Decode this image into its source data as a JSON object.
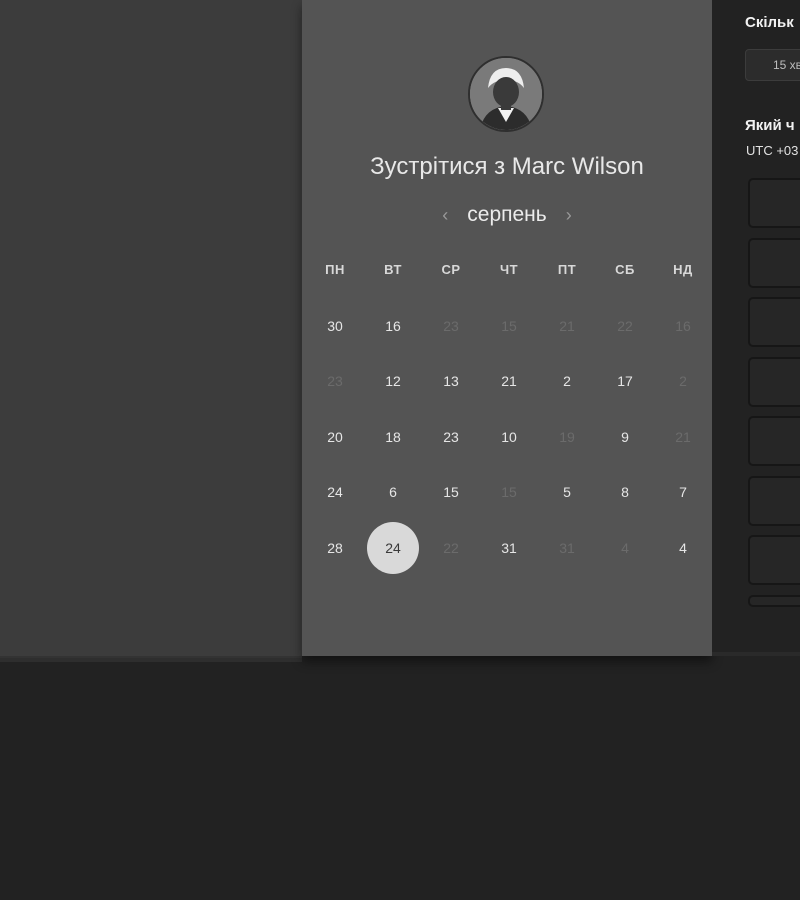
{
  "calendar": {
    "title": "Зустрітися з Marc Wilson",
    "month": "серпень",
    "prev_icon": "chevron-left-icon",
    "next_icon": "chevron-right-icon",
    "weekdays": [
      "ПН",
      "ВТ",
      "СР",
      "ЧТ",
      "ПТ",
      "СБ",
      "НД"
    ],
    "days": [
      {
        "label": "30",
        "available": true
      },
      {
        "label": "16",
        "available": true
      },
      {
        "label": "23",
        "available": false
      },
      {
        "label": "15",
        "available": false
      },
      {
        "label": "21",
        "available": false
      },
      {
        "label": "22",
        "available": false
      },
      {
        "label": "16",
        "available": false
      },
      {
        "label": "23",
        "available": false
      },
      {
        "label": "12",
        "available": true
      },
      {
        "label": "13",
        "available": true
      },
      {
        "label": "21",
        "available": true
      },
      {
        "label": "2",
        "available": true
      },
      {
        "label": "17",
        "available": true
      },
      {
        "label": "2",
        "available": false
      },
      {
        "label": "20",
        "available": true
      },
      {
        "label": "18",
        "available": true
      },
      {
        "label": "23",
        "available": true
      },
      {
        "label": "10",
        "available": true
      },
      {
        "label": "19",
        "available": false
      },
      {
        "label": "9",
        "available": true
      },
      {
        "label": "21",
        "available": false
      },
      {
        "label": "24",
        "available": true
      },
      {
        "label": "6",
        "available": true
      },
      {
        "label": "15",
        "available": true
      },
      {
        "label": "15",
        "available": false
      },
      {
        "label": "5",
        "available": true
      },
      {
        "label": "8",
        "available": true
      },
      {
        "label": "7",
        "available": true
      },
      {
        "label": "28",
        "available": true
      },
      {
        "label": "24",
        "available": true,
        "selected": true
      },
      {
        "label": "22",
        "available": false
      },
      {
        "label": "31",
        "available": true
      },
      {
        "label": "31",
        "available": false
      },
      {
        "label": "4",
        "available": false
      },
      {
        "label": "4",
        "available": true
      }
    ]
  },
  "sidebar": {
    "duration_heading": "Скільк",
    "duration_value": "15 хв",
    "time_heading": "Який ч",
    "timezone": "UTC +03",
    "slots_count": 8
  },
  "colors": {
    "background": "#222222",
    "left_pane": "#3c3c3c",
    "calendar_panel": "#545454",
    "selected_day": "#d9d9d9"
  }
}
